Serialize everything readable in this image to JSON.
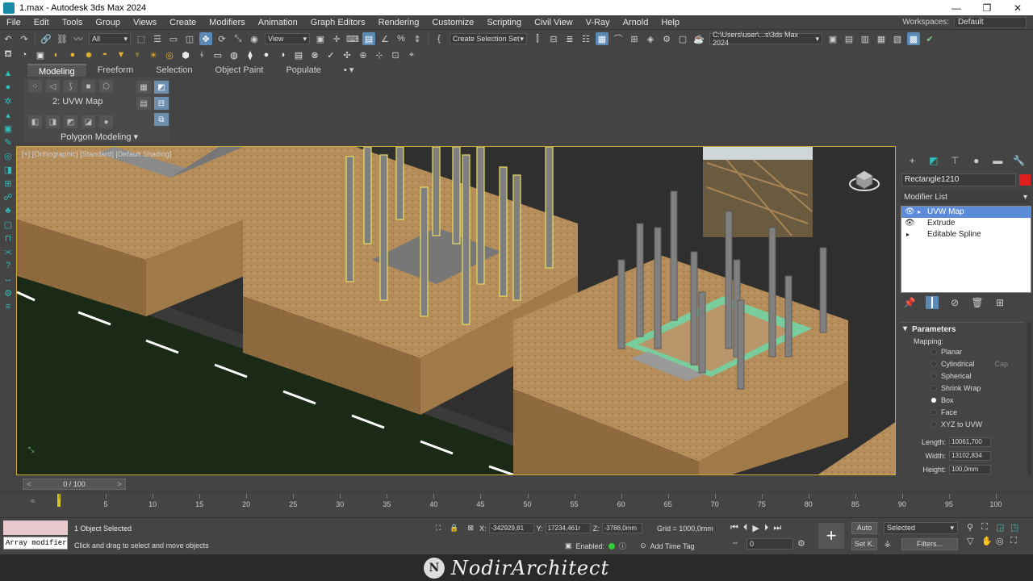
{
  "window": {
    "title": "1.max - Autodesk 3ds Max 2024",
    "minimize": "—",
    "maximize": "❐",
    "close": "✕"
  },
  "menu": [
    "File",
    "Edit",
    "Tools",
    "Group",
    "Views",
    "Create",
    "Modifiers",
    "Animation",
    "Graph Editors",
    "Rendering",
    "Customize",
    "Scripting",
    "Civil View",
    "V-Ray",
    "Arnold",
    "Help"
  ],
  "workspaces": {
    "label": "Workspaces:",
    "value": "Default"
  },
  "toolbar": {
    "selection_filter": "All",
    "ref_coord": "View",
    "named_selection": "Create Selection Set",
    "project_path": "C:\\Users\\user\\...s\\3ds Max 2024"
  },
  "ribbon": {
    "tabs": [
      "Modeling",
      "Freeform",
      "Selection",
      "Object Paint",
      "Populate"
    ],
    "active_tab": "Modeling",
    "modifier_label": "2: UVW Map",
    "panel_label": "Polygon Modeling ▾"
  },
  "viewport": {
    "label": "[+] [Orthographic] [Standard] [Default Shading]"
  },
  "command_panel": {
    "object_name": "Rectangle1210",
    "object_color": "#e02020",
    "modifier_list": "Modifier List",
    "stack": [
      {
        "name": "UVW Map",
        "selected": true,
        "eye": "👁",
        "expand": "▸"
      },
      {
        "name": "Extrude",
        "selected": false,
        "eye": "👁",
        "expand": ""
      },
      {
        "name": "Editable Spline",
        "selected": false,
        "eye": "",
        "expand": "▸"
      }
    ],
    "params_title": "Parameters",
    "mapping_label": "Mapping:",
    "mapping_options": [
      {
        "label": "Planar",
        "selected": false
      },
      {
        "label": "Cylindrical",
        "selected": false,
        "extra": "Cap"
      },
      {
        "label": "Spherical",
        "selected": false
      },
      {
        "label": "Shrink Wrap",
        "selected": false
      },
      {
        "label": "Box",
        "selected": true
      },
      {
        "label": "Face",
        "selected": false
      },
      {
        "label": "XYZ to UVW",
        "selected": false
      }
    ],
    "length_label": "Length:",
    "length_value": "10061,700",
    "width_label": "Width:",
    "width_value": "13102,834",
    "height_label": "Height:",
    "height_value": "100,0mm"
  },
  "timeline": {
    "slider_label": "0 / 100",
    "ticks": [
      "0",
      "5",
      "10",
      "15",
      "20",
      "25",
      "30",
      "35",
      "40",
      "45",
      "50",
      "55",
      "60",
      "65",
      "70",
      "75",
      "80",
      "85",
      "90",
      "95",
      "100"
    ]
  },
  "status": {
    "maxscript": "Array modifier",
    "objects_selected": "1 Object Selected",
    "prompt": "Click and drag to select and move objects",
    "x_label": "X:",
    "x_value": "-342929,81",
    "y_label": "Y:",
    "y_value": "17234,461r",
    "z_label": "Z:",
    "z_value": "-3788,0mm",
    "grid": "Grid = 1000,0mm",
    "enabled": "Enabled:",
    "add_time_tag": "Add Time Tag",
    "auto": "Auto",
    "set_key": "Set K.",
    "selected_dd": "Selected",
    "filters": "Filters...",
    "frame": "0"
  },
  "watermark": {
    "logo": "N",
    "text": "NodirArchitect"
  }
}
